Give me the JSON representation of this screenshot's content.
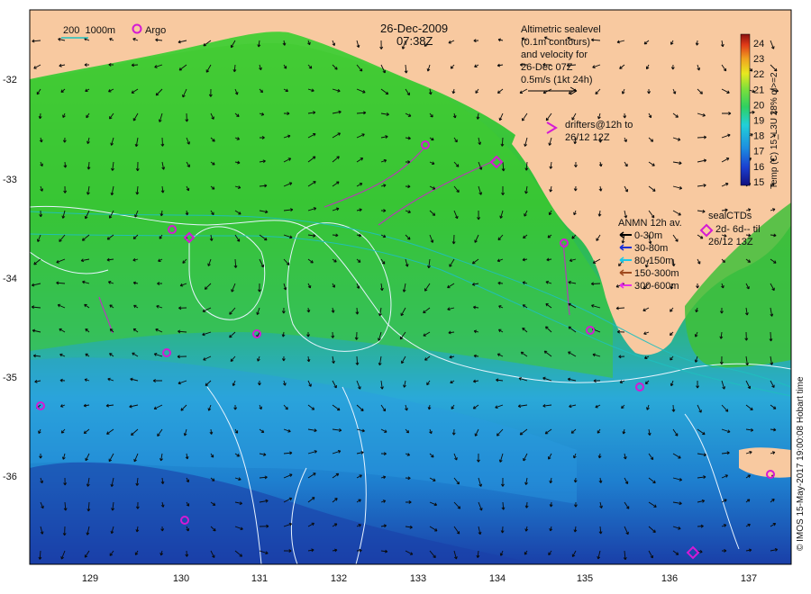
{
  "header": {
    "date": "26-Dec-2009",
    "time": "07:38Z",
    "isobath_legend": "200  1000m",
    "argo_label": "Argo"
  },
  "altimetry": {
    "lines": [
      "Altimetric sealevel",
      "(0.1m contours)",
      "and velocity for",
      "26-Dec 07Z",
      "0.5m/s (1kt 24h)"
    ]
  },
  "drifters": {
    "lines": [
      "drifters@12h to",
      "26/12 12Z"
    ]
  },
  "anmn": {
    "title": "ANMN 12h av.",
    "items": [
      {
        "label": "0-30m",
        "color": "#000000"
      },
      {
        "label": "30-80m",
        "color": "#1a2fd6"
      },
      {
        "label": "80-150m",
        "color": "#19c8e8"
      },
      {
        "label": "150-300m",
        "color": "#a04a1e"
      },
      {
        "label": "300-600m",
        "color": "#e62de6"
      }
    ]
  },
  "sealctd": {
    "lines": [
      "sealCTDs",
      "2d- 6d-- til",
      "26/12 13Z"
    ]
  },
  "colorbar": {
    "ticks": [
      "24",
      "23",
      "22",
      "21",
      "20",
      "19",
      "18",
      "17",
      "16",
      "15"
    ],
    "label": "Temp (C) 15_L3U 28% ql>=2"
  },
  "axes": {
    "x_ticks": [
      "129",
      "130",
      "131",
      "132",
      "133",
      "134",
      "135",
      "136",
      "137"
    ],
    "y_ticks": [
      "-32",
      "-33",
      "-34",
      "-35",
      "-36"
    ]
  },
  "credit": "© IMOS 15-May-2017 19:00:08 Hobart time",
  "colors": {
    "land": "#f8c9a0",
    "warm_ocean": "#38c23a",
    "mid_ocean": "#2db3d6",
    "cold_ocean": "#1a4fb8",
    "argo": "#d41ad4",
    "contour": "#e8f4ff",
    "isobath": "#1fbfbf"
  }
}
